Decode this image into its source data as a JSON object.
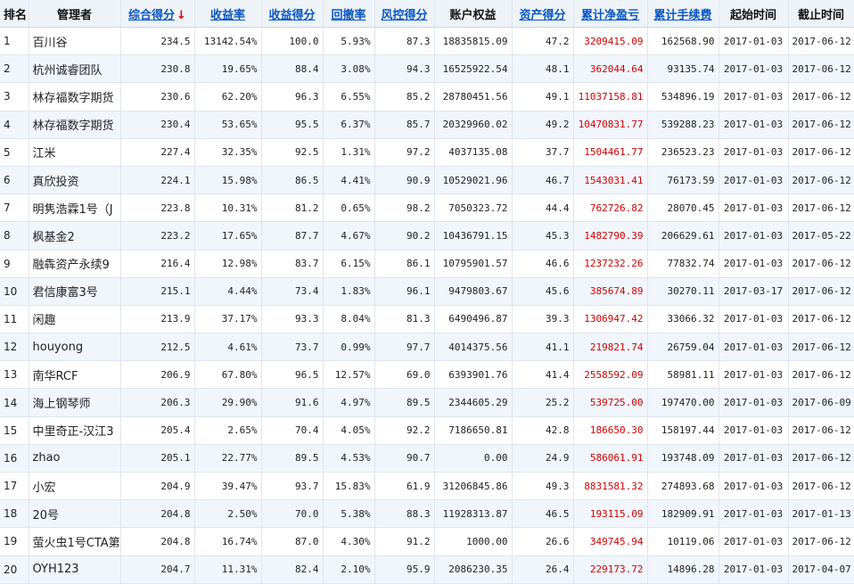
{
  "table": {
    "headers": {
      "rank": "排名",
      "manager": "管理者",
      "composite": "综合得分",
      "composite_arrow": "↓",
      "return_rate": "收益率",
      "return_score": "收益得分",
      "drawdown": "回撤率",
      "risk_score": "风控得分",
      "equity": "账户权益",
      "asset_score": "资产得分",
      "cum_pnl": "累计净盈亏",
      "cum_fee": "累计手续费",
      "start": "起始时间",
      "end": "截止时间"
    },
    "rows": [
      {
        "rank": "1",
        "manager": "百川谷",
        "composite": "234.5",
        "return_rate": "13142.54%",
        "return_score": "100.0",
        "drawdown": "5.93%",
        "risk_score": "87.3",
        "equity": "18835815.09",
        "asset_score": "47.2",
        "cum_pnl": "3209415.09",
        "cum_fee": "162568.90",
        "start": "2017-01-03",
        "end": "2017-06-12"
      },
      {
        "rank": "2",
        "manager": "杭州诚睿团队",
        "composite": "230.8",
        "return_rate": "19.65%",
        "return_score": "88.4",
        "drawdown": "3.08%",
        "risk_score": "94.3",
        "equity": "16525922.54",
        "asset_score": "48.1",
        "cum_pnl": "362044.64",
        "cum_fee": "93135.74",
        "start": "2017-01-03",
        "end": "2017-06-12"
      },
      {
        "rank": "3",
        "manager": "林存福数字期货",
        "composite": "230.6",
        "return_rate": "62.20%",
        "return_score": "96.3",
        "drawdown": "6.55%",
        "risk_score": "85.2",
        "equity": "28780451.56",
        "asset_score": "49.1",
        "cum_pnl": "11037158.81",
        "cum_fee": "534896.19",
        "start": "2017-01-03",
        "end": "2017-06-12"
      },
      {
        "rank": "4",
        "manager": "林存福数字期货",
        "composite": "230.4",
        "return_rate": "53.65%",
        "return_score": "95.5",
        "drawdown": "6.37%",
        "risk_score": "85.7",
        "equity": "20329960.02",
        "asset_score": "49.2",
        "cum_pnl": "10470831.77",
        "cum_fee": "539288.23",
        "start": "2017-01-03",
        "end": "2017-06-12"
      },
      {
        "rank": "5",
        "manager": "江米",
        "composite": "227.4",
        "return_rate": "32.35%",
        "return_score": "92.5",
        "drawdown": "1.31%",
        "risk_score": "97.2",
        "equity": "4037135.08",
        "asset_score": "37.7",
        "cum_pnl": "1504461.77",
        "cum_fee": "236523.23",
        "start": "2017-01-03",
        "end": "2017-06-12"
      },
      {
        "rank": "6",
        "manager": "真欣投资",
        "composite": "224.1",
        "return_rate": "15.98%",
        "return_score": "86.5",
        "drawdown": "4.41%",
        "risk_score": "90.9",
        "equity": "10529021.96",
        "asset_score": "46.7",
        "cum_pnl": "1543031.41",
        "cum_fee": "76173.59",
        "start": "2017-01-03",
        "end": "2017-06-12"
      },
      {
        "rank": "7",
        "manager": "明隽浩霖1号（J",
        "composite": "223.8",
        "return_rate": "10.31%",
        "return_score": "81.2",
        "drawdown": "0.65%",
        "risk_score": "98.2",
        "equity": "7050323.72",
        "asset_score": "44.4",
        "cum_pnl": "762726.82",
        "cum_fee": "28070.45",
        "start": "2017-01-03",
        "end": "2017-06-12"
      },
      {
        "rank": "8",
        "manager": "枫基金2",
        "composite": "223.2",
        "return_rate": "17.65%",
        "return_score": "87.7",
        "drawdown": "4.67%",
        "risk_score": "90.2",
        "equity": "10436791.15",
        "asset_score": "45.3",
        "cum_pnl": "1482790.39",
        "cum_fee": "206629.61",
        "start": "2017-01-03",
        "end": "2017-05-22"
      },
      {
        "rank": "9",
        "manager": "融犇资产永续9",
        "composite": "216.4",
        "return_rate": "12.98%",
        "return_score": "83.7",
        "drawdown": "6.15%",
        "risk_score": "86.1",
        "equity": "10795901.57",
        "asset_score": "46.6",
        "cum_pnl": "1237232.26",
        "cum_fee": "77832.74",
        "start": "2017-01-03",
        "end": "2017-06-12"
      },
      {
        "rank": "10",
        "manager": "君信康富3号",
        "composite": "215.1",
        "return_rate": "4.44%",
        "return_score": "73.4",
        "drawdown": "1.83%",
        "risk_score": "96.1",
        "equity": "9479803.67",
        "asset_score": "45.6",
        "cum_pnl": "385674.89",
        "cum_fee": "30270.11",
        "start": "2017-03-17",
        "end": "2017-06-12"
      },
      {
        "rank": "11",
        "manager": "闲趣",
        "composite": "213.9",
        "return_rate": "37.17%",
        "return_score": "93.3",
        "drawdown": "8.04%",
        "risk_score": "81.3",
        "equity": "6490496.87",
        "asset_score": "39.3",
        "cum_pnl": "1306947.42",
        "cum_fee": "33066.32",
        "start": "2017-01-03",
        "end": "2017-06-12"
      },
      {
        "rank": "12",
        "manager": "houyong",
        "composite": "212.5",
        "return_rate": "4.61%",
        "return_score": "73.7",
        "drawdown": "0.99%",
        "risk_score": "97.7",
        "equity": "4014375.56",
        "asset_score": "41.1",
        "cum_pnl": "219821.74",
        "cum_fee": "26759.04",
        "start": "2017-01-03",
        "end": "2017-06-12"
      },
      {
        "rank": "13",
        "manager": "南华RCF",
        "composite": "206.9",
        "return_rate": "67.80%",
        "return_score": "96.5",
        "drawdown": "12.57%",
        "risk_score": "69.0",
        "equity": "6393901.76",
        "asset_score": "41.4",
        "cum_pnl": "2558592.09",
        "cum_fee": "58981.11",
        "start": "2017-01-03",
        "end": "2017-06-12"
      },
      {
        "rank": "14",
        "manager": "海上钢琴师",
        "composite": "206.3",
        "return_rate": "29.90%",
        "return_score": "91.6",
        "drawdown": "4.97%",
        "risk_score": "89.5",
        "equity": "2344605.29",
        "asset_score": "25.2",
        "cum_pnl": "539725.00",
        "cum_fee": "197470.00",
        "start": "2017-01-03",
        "end": "2017-06-09"
      },
      {
        "rank": "15",
        "manager": "中里奇正-汉江3",
        "composite": "205.4",
        "return_rate": "2.65%",
        "return_score": "70.4",
        "drawdown": "4.05%",
        "risk_score": "92.2",
        "equity": "7186650.81",
        "asset_score": "42.8",
        "cum_pnl": "186650.30",
        "cum_fee": "158197.44",
        "start": "2017-01-03",
        "end": "2017-06-12"
      },
      {
        "rank": "16",
        "manager": "zhao",
        "composite": "205.1",
        "return_rate": "22.77%",
        "return_score": "89.5",
        "drawdown": "4.53%",
        "risk_score": "90.7",
        "equity": "0.00",
        "asset_score": "24.9",
        "cum_pnl": "586061.91",
        "cum_fee": "193748.09",
        "start": "2017-01-03",
        "end": "2017-06-12"
      },
      {
        "rank": "17",
        "manager": "小宏",
        "composite": "204.9",
        "return_rate": "39.47%",
        "return_score": "93.7",
        "drawdown": "15.83%",
        "risk_score": "61.9",
        "equity": "31206845.86",
        "asset_score": "49.3",
        "cum_pnl": "8831581.32",
        "cum_fee": "274893.68",
        "start": "2017-01-03",
        "end": "2017-06-12"
      },
      {
        "rank": "18",
        "manager": "20号",
        "composite": "204.8",
        "return_rate": "2.50%",
        "return_score": "70.0",
        "drawdown": "5.38%",
        "risk_score": "88.3",
        "equity": "11928313.87",
        "asset_score": "46.5",
        "cum_pnl": "193115.09",
        "cum_fee": "182909.91",
        "start": "2017-01-03",
        "end": "2017-01-13"
      },
      {
        "rank": "19",
        "manager": "萤火虫1号CTA第",
        "composite": "204.8",
        "return_rate": "16.74%",
        "return_score": "87.0",
        "drawdown": "4.30%",
        "risk_score": "91.2",
        "equity": "1000.00",
        "asset_score": "26.6",
        "cum_pnl": "349745.94",
        "cum_fee": "10119.06",
        "start": "2017-01-03",
        "end": "2017-06-12"
      },
      {
        "rank": "20",
        "manager": "OYH123",
        "composite": "204.7",
        "return_rate": "11.31%",
        "return_score": "82.4",
        "drawdown": "2.10%",
        "risk_score": "95.9",
        "equity": "2086230.35",
        "asset_score": "26.4",
        "cum_pnl": "229173.72",
        "cum_fee": "14896.28",
        "start": "2017-01-03",
        "end": "2017-04-07"
      }
    ]
  }
}
